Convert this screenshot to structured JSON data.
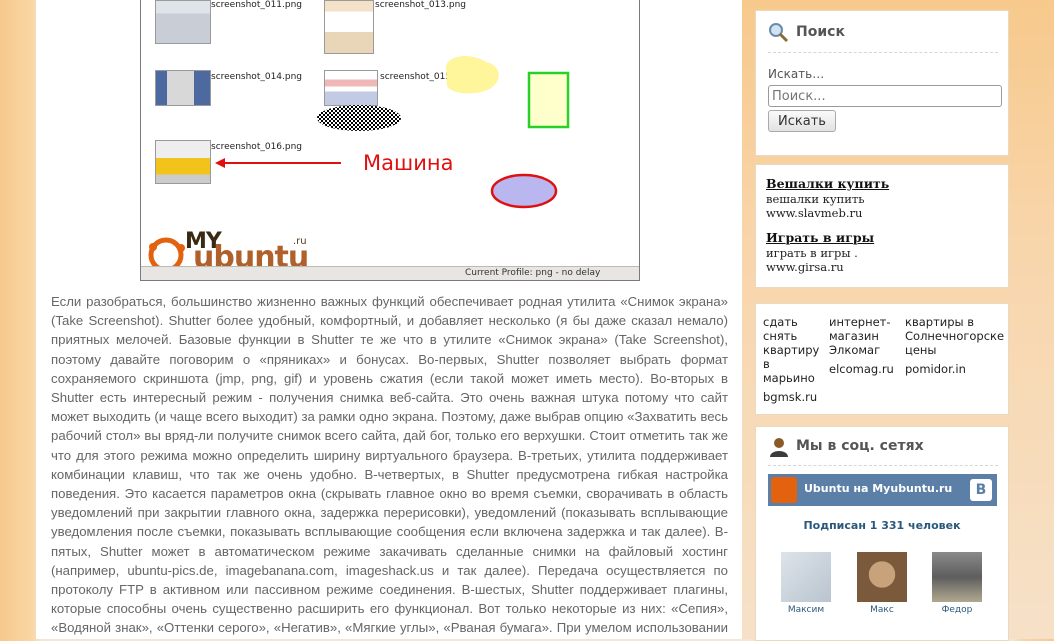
{
  "screenshot": {
    "thumbnails": [
      {
        "name": "screenshot_011.png"
      },
      {
        "name": "screenshot_013.png"
      },
      {
        "name": "screenshot_014.png"
      },
      {
        "name": "screenshot_015.png"
      },
      {
        "name": "screenshot_016.png"
      }
    ],
    "annotation": "Машина",
    "logo_text_top": "MY",
    "logo_text_main": "ubuntu",
    "logo_suffix": ".ru",
    "status_bar": "Current Profile: png - no delay",
    "colors": {
      "annotation_red": "#e01010",
      "logo_orange": "#e2620f",
      "logo_brown": "#5a3a1a"
    }
  },
  "article": {
    "text": "Если разобраться, большинство жизненно важных функций обеспечивает родная утилита «Снимок экрана» (Take Screenshot). Shutter более удобный, комфортный, и добавляет несколько (я бы даже сказал немало) приятных мелочей. Базовые функции в Shutter те же что в утилите «Снимок экрана» (Take Screenshot), поэтому давайте поговорим о «пряниках» и бонусах. Во-первых, Shutter позволяет выбрать формат сохраняемого скриншота (jmp, png, gif) и уровень сжатия (если такой может иметь место). Во-вторых в Shutter есть интересный режим - получения снимка веб-сайта. Это очень важная штука потому что сайт может выходить (и чаще всего выходит) за рамки одно экрана. Поэтому, даже выбрав опцию «Захватить весь рабочий стол» вы вряд-ли получите снимок всего сайта, дай бог, только его верхушки. Стоит отметить так же что для этого режима можно определить ширину виртуального браузера. В-третьих, утилита поддерживает комбинации клавиш, что так же очень удобно. В-четвертых, в Shutter предусмотрена гибкая настройка поведения. Это касается параметров окна (скрывать главное окно во время съемки, сворачивать в область уведомлений при закрытии главного окна, задержка перерисовки), уведомлений (показывать всплывающие уведомления после съемки, показывать всплывающие сообщения если включена задержка и так далее). В-пятых, Shutter может в автоматическом режиме закачивать сделанные снимки на файловый хостинг (например, ubuntu-pics.de, imagebanana.com, imageshack.us и так далее). Передача осуществляется по протоколу FTP в активном или пассивном режиме соединения. В-шестых, Shutter поддерживает плагины, которые способны очень существенно расширить его функционал. Вот только некоторые из них: «Сепия», «Водяной знак», «Оттенки серого», «Негатив», «Мягкие углы», «Рваная бумага». При умелом использовании этих плагинов, теоретически"
  },
  "search_widget": {
    "title": "Поиск",
    "label": "Искать…",
    "placeholder": "Поиск...",
    "button": "Искать"
  },
  "ads_widget": {
    "items": [
      {
        "link": "Вешалки купить",
        "text": "вешалки купить",
        "url": "www.slavmeb.ru"
      },
      {
        "link": "Играть в игры",
        "text": "играть в игры .",
        "url": "www.girsa.ru"
      }
    ]
  },
  "ads_columns": {
    "col1_text": "сдать снять квартиру в марьино",
    "col1_site": "bgmsk.ru",
    "col2_text": "интернет-магазин Элкомаг",
    "col2_site": "elcomag.ru",
    "col3_text": "квартиры в Солнечногорске цены",
    "col3_site": "pomidor.in"
  },
  "social_widget": {
    "title": "Мы в соц. сетях",
    "group_name": "Ubuntu на Myubuntu.ru",
    "vk_letter": "B",
    "subscribers": "Подписан 1 331 человек",
    "friends": [
      {
        "name": "Максим"
      },
      {
        "name": "Макс"
      },
      {
        "name": "Федор"
      }
    ],
    "colors": {
      "vk_blue": "#5b7fa6",
      "link_blue": "#2b587a"
    }
  }
}
